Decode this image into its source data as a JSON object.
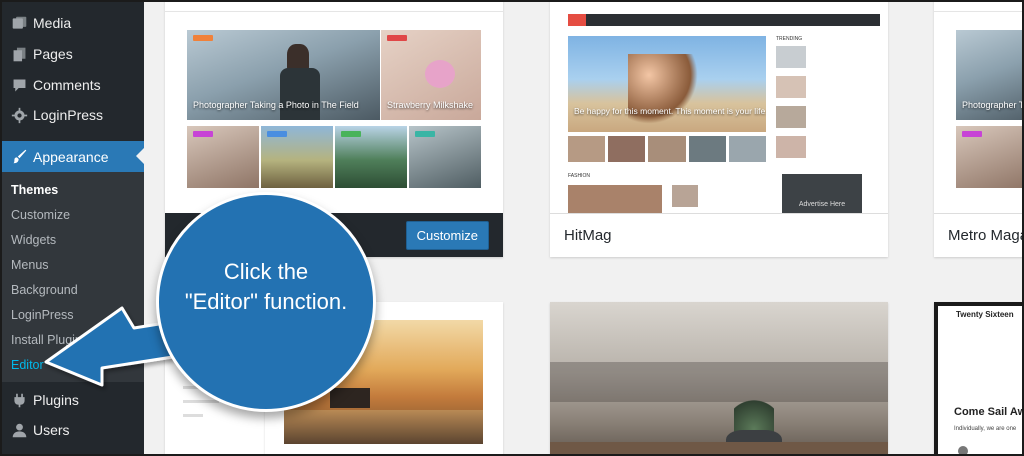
{
  "sidebar": {
    "items": [
      {
        "label": "Media",
        "icon": "media-icon"
      },
      {
        "label": "Pages",
        "icon": "pages-icon"
      },
      {
        "label": "Comments",
        "icon": "comments-icon"
      },
      {
        "label": "LoginPress",
        "icon": "gear-icon"
      },
      {
        "label": "Appearance",
        "icon": "paintbrush-icon"
      },
      {
        "label": "Plugins",
        "icon": "plugin-icon"
      },
      {
        "label": "Users",
        "icon": "user-icon"
      }
    ],
    "submenu": [
      "Themes",
      "Customize",
      "Widgets",
      "Menus",
      "Background",
      "LoginPress",
      "Install Plugins",
      "Editor"
    ]
  },
  "themes": {
    "active_button": "Customize",
    "hitmag_name": "HitMag",
    "metro_name": "Metro Magazine",
    "active_tile_1": "Photographer Taking a Photo in The Field",
    "active_tile_2": "Strawberry Milkshake",
    "hitmag_hero": "Be happy for this moment. This moment is your life.",
    "metro_tile": "Photographer Taking a Photo in The Field",
    "adv_text": "Advertise Here",
    "section_fashion": "FASHION",
    "section_trending": "TRENDING",
    "ts_title": "Twenty Sixteen",
    "ts_headline": "Come Sail Away",
    "ts_body": "Individually, we are one"
  },
  "callout": {
    "line1": "Click the",
    "line2": "\"Editor\" function."
  },
  "colors": {
    "sidebar_bg": "#23282d",
    "accent": "#2a79b6",
    "callout": "#2372b2",
    "link": "#00b9eb"
  }
}
